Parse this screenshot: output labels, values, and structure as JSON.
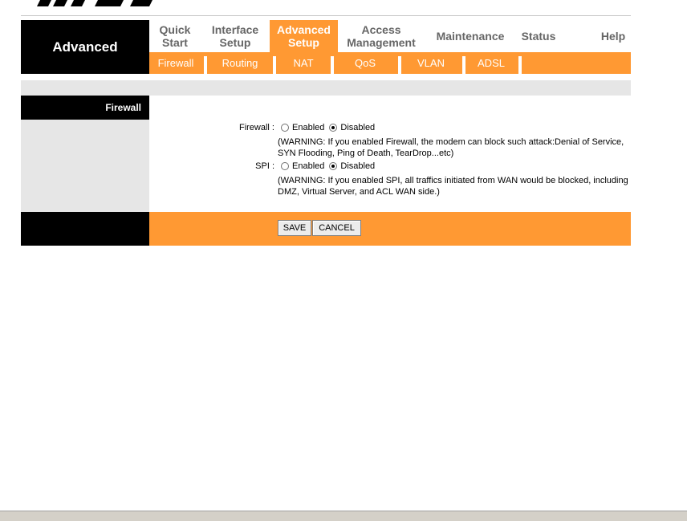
{
  "header": {
    "section_label": "Advanced"
  },
  "nav": {
    "items": [
      {
        "label_line1": "Quick",
        "label_line2": "Start"
      },
      {
        "label_line1": "Interface",
        "label_line2": "Setup"
      },
      {
        "label_line1": "Advanced",
        "label_line2": "Setup"
      },
      {
        "label_line1": "Access",
        "label_line2": "Management"
      },
      {
        "label_line1": "Maintenance",
        "label_line2": ""
      },
      {
        "label_line1": "Status",
        "label_line2": ""
      },
      {
        "label_line1": "Help",
        "label_line2": ""
      }
    ],
    "active_index": 2
  },
  "subnav": {
    "items": [
      "Firewall",
      "Routing",
      "NAT",
      "QoS",
      "VLAN",
      "ADSL"
    ]
  },
  "panel": {
    "title": "Firewall"
  },
  "form": {
    "firewall": {
      "label": "Firewall :",
      "enabled_label": "Enabled",
      "disabled_label": "Disabled",
      "selected": "Disabled",
      "warning_line1": "(WARNING: If you enabled Firewall, the modem can block such attack:Denial of Service,",
      "warning_line2": "SYN Flooding, Ping of Death, TearDrop...etc)"
    },
    "spi": {
      "label": "SPI :",
      "enabled_label": "Enabled",
      "disabled_label": "Disabled",
      "selected": "Disabled",
      "warning_line1": "(WARNING: If you enabled SPI, all traffics initiated from WAN would be blocked, including",
      "warning_line2": "DMZ, Virtual Server, and ACL WAN side.)"
    }
  },
  "buttons": {
    "save": "SAVE",
    "cancel": "CANCEL"
  },
  "colors": {
    "accent": "#ff9933",
    "black": "#000000",
    "panel_gray": "#e6e6e6"
  }
}
